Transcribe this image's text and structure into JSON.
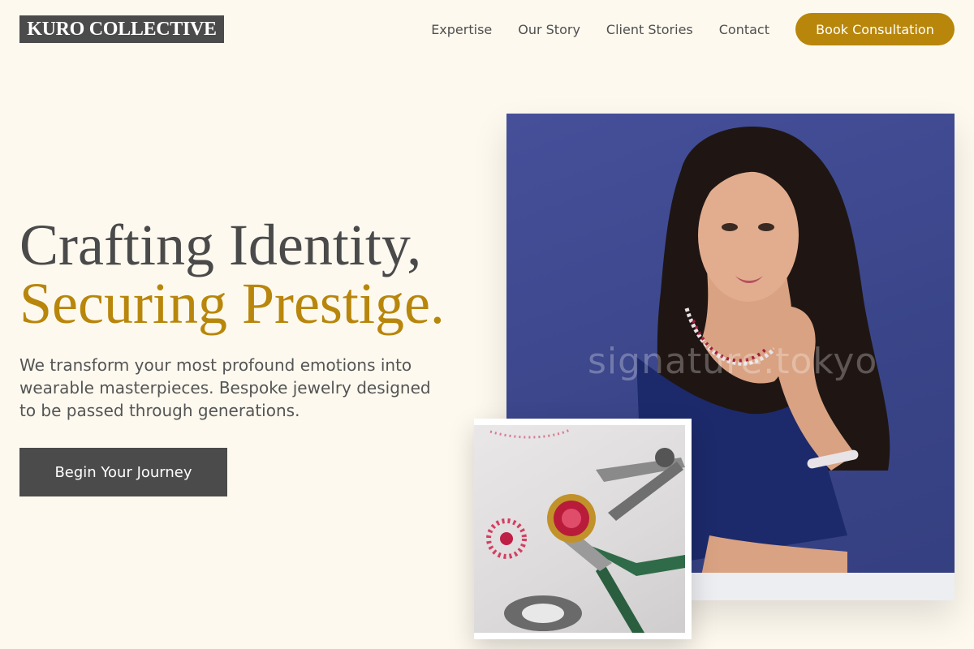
{
  "brand": {
    "logo_text": "KURO COLLECTIVE"
  },
  "nav": {
    "links": [
      "Expertise",
      "Our Story",
      "Client Stories",
      "Contact"
    ],
    "cta_label": "Book Consultation"
  },
  "hero": {
    "headline_line1": "Crafting Identity,",
    "headline_line2": "Securing Prestige.",
    "lead": "We transform your most profound emotions into wearable masterpieces. Bespoke jewelry designed to be passed through generations.",
    "cta_label": "Begin Your Journey"
  },
  "images": {
    "main_watermark": "signature.tokyo"
  },
  "colors": {
    "background": "#fdf9ef",
    "accent_gold": "#b8860b",
    "charcoal": "#4b4b4b",
    "photo_backdrop": "#3f4a8e"
  }
}
